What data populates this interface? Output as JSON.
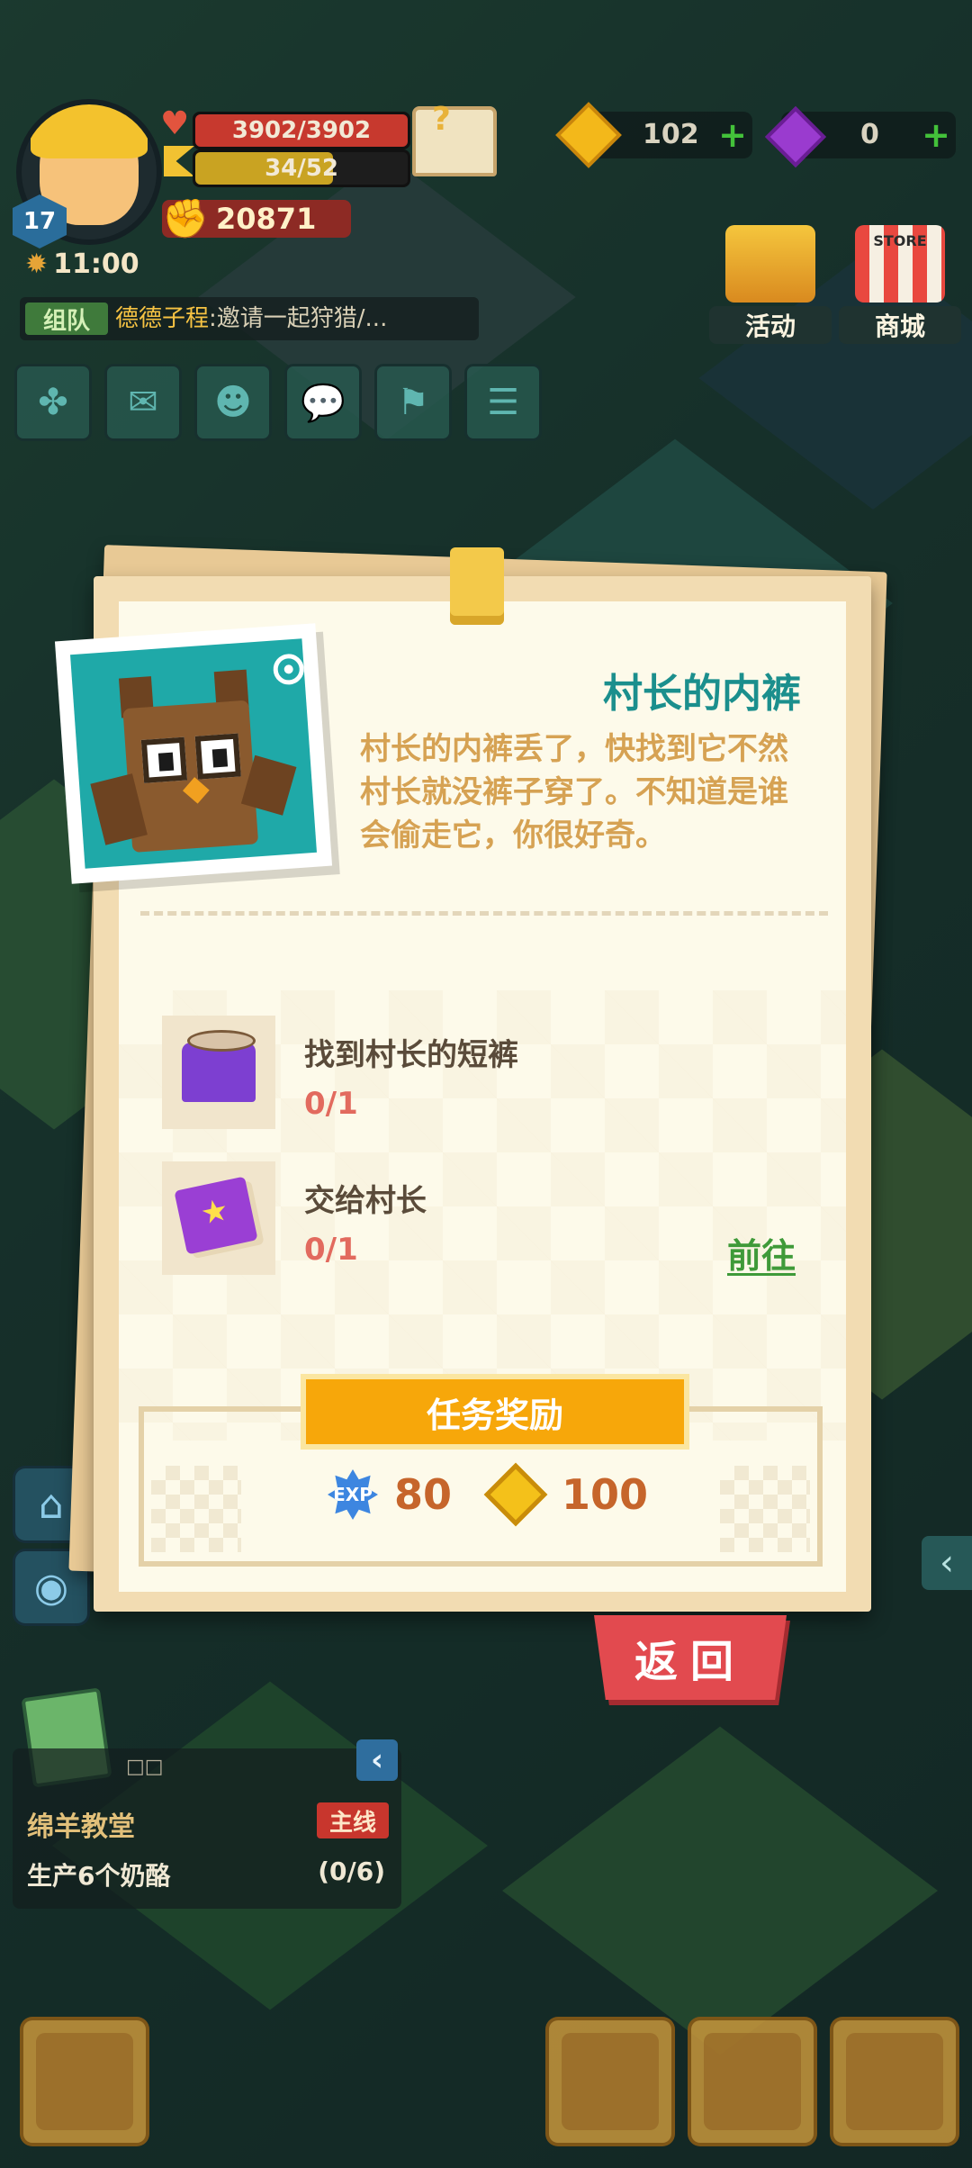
{
  "hud": {
    "level": "17",
    "hp": "3902/3902",
    "energy": "34/52",
    "power": "20871",
    "time": "11:00",
    "gold": "102",
    "gems": "0"
  },
  "team": {
    "tag": "组队",
    "name": "德德子程",
    "message": ":邀请一起狩猎/..."
  },
  "top_buttons": {
    "activity": "活动",
    "store": "商城",
    "store_sign": "STORE"
  },
  "quest": {
    "title": "村长的内裤",
    "description": "村长的内裤丢了，快找到它不然村长就没裤子穿了。不知道是谁会偷走它，你很好奇。",
    "tasks": [
      {
        "name": "找到村长的短裤",
        "progress": "0/1"
      },
      {
        "name": "交给村长",
        "progress": "0/1"
      }
    ],
    "goto_label": "前往",
    "reward_label": "任务奖励",
    "exp_icon_text": "EXP",
    "reward_exp": "80",
    "reward_gold": "100",
    "back_label": "返回"
  },
  "tracker": {
    "title": "绵羊教堂",
    "tag": "主线",
    "goal": "生产6个奶酪",
    "progress": "(0/6)",
    "dots": "□□"
  }
}
